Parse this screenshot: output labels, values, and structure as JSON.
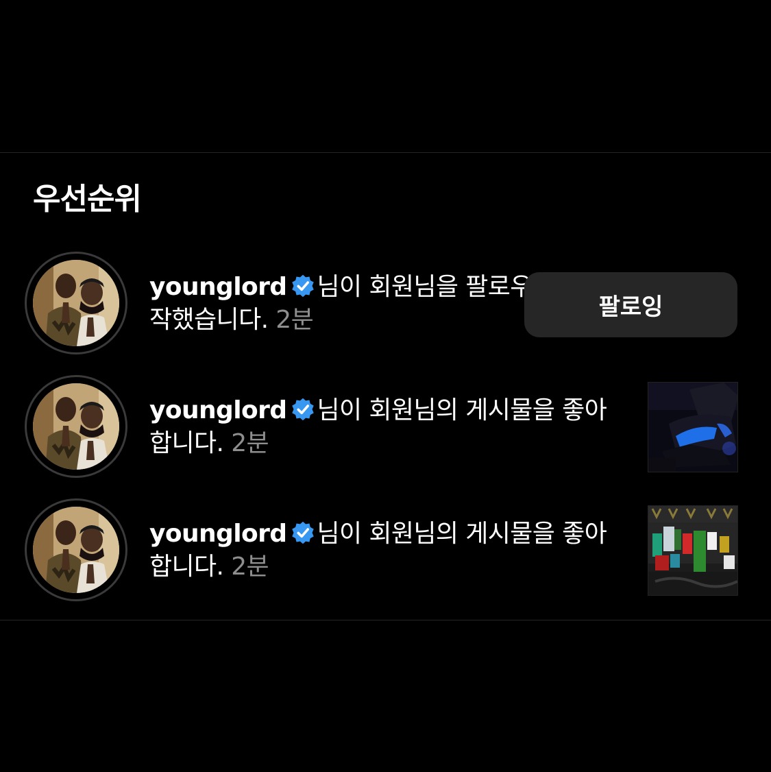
{
  "section": {
    "title": "우선순위"
  },
  "notifications": [
    {
      "username": "younglord",
      "message": "님이 회원님을 팔로우하기 시작했습니다. ",
      "time": "2분",
      "action_label": "팔로잉"
    },
    {
      "username": "younglord",
      "message": "님이 회원님의 게시물을 좋아합니다. ",
      "time": "2분"
    },
    {
      "username": "younglord",
      "message": "님이 회원님의 게시물을 좋아합니다. ",
      "time": "2분"
    }
  ],
  "colors": {
    "background": "#000000",
    "secondary_text": "#8e8e8e",
    "button_bg": "#262626",
    "verified_badge": "#3897f0"
  },
  "icons": [
    "verified-badge-icon",
    "avatar-photo",
    "post-thumbnail-shoe",
    "post-thumbnail-clothing"
  ]
}
